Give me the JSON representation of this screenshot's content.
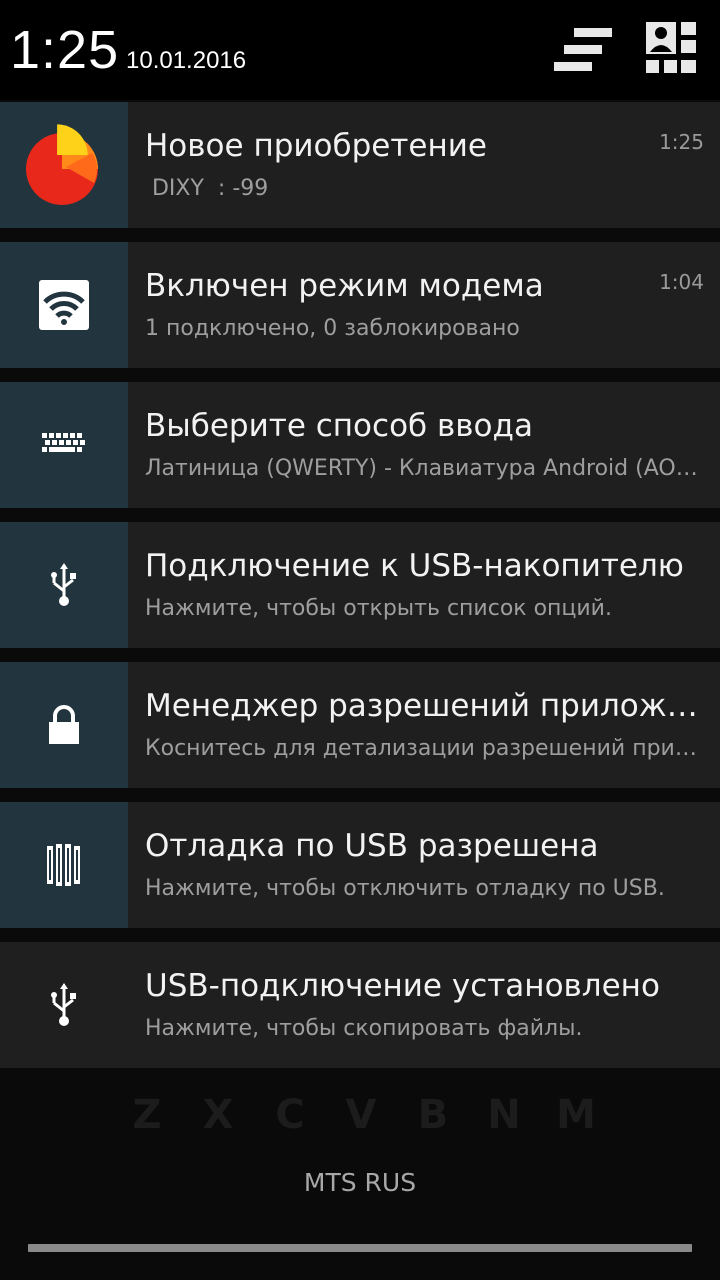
{
  "status": {
    "clock": "1:25",
    "date": "10.01.2016"
  },
  "header": {
    "clear_icon": "clear-all-icon",
    "settings_icon": "quick-settings-icon"
  },
  "notifications": [
    {
      "title": "Новое приобретение",
      "subtitle": " DIXY  : -99",
      "time": "1:25",
      "icon": "pie-chart-app-icon"
    },
    {
      "title": "Включен режим модема",
      "subtitle": "1 подключено, 0 заблокировано",
      "time": "1:04",
      "icon": "wifi-hotspot-icon"
    },
    {
      "title": "Выберите способ ввода",
      "subtitle": "Латиница (QWERTY) - Клавиатура Android (AOSP)",
      "icon": "keyboard-icon"
    },
    {
      "title": "Подключение к USB-накопителю",
      "subtitle": "Нажмите, чтобы открыть список опций.",
      "icon": "usb-icon"
    },
    {
      "title": "Менеджер разрешений приложений",
      "subtitle": "Коснитесь для детализации разрешений приложений",
      "icon": "lock-icon"
    },
    {
      "title": "Отладка по USB разрешена",
      "subtitle": "Нажмите, чтобы отключить отладку по USB.",
      "icon": "usb-debug-icon"
    },
    {
      "title": "USB-подключение установлено",
      "subtitle": "Нажмите, чтобы скопировать файлы.",
      "icon": "usb-icon"
    }
  ],
  "footer": {
    "carrier": "MTS RUS"
  },
  "background_keys": [
    "Z",
    "X",
    "C",
    "V",
    "B",
    "N",
    "M"
  ],
  "colors": {
    "header_bg": "#000000",
    "card_bg": "#1f1f1f",
    "icon_bg": "#22353f",
    "accent_orange": "#ff6a1a",
    "accent_yellow": "#ffd21a"
  }
}
